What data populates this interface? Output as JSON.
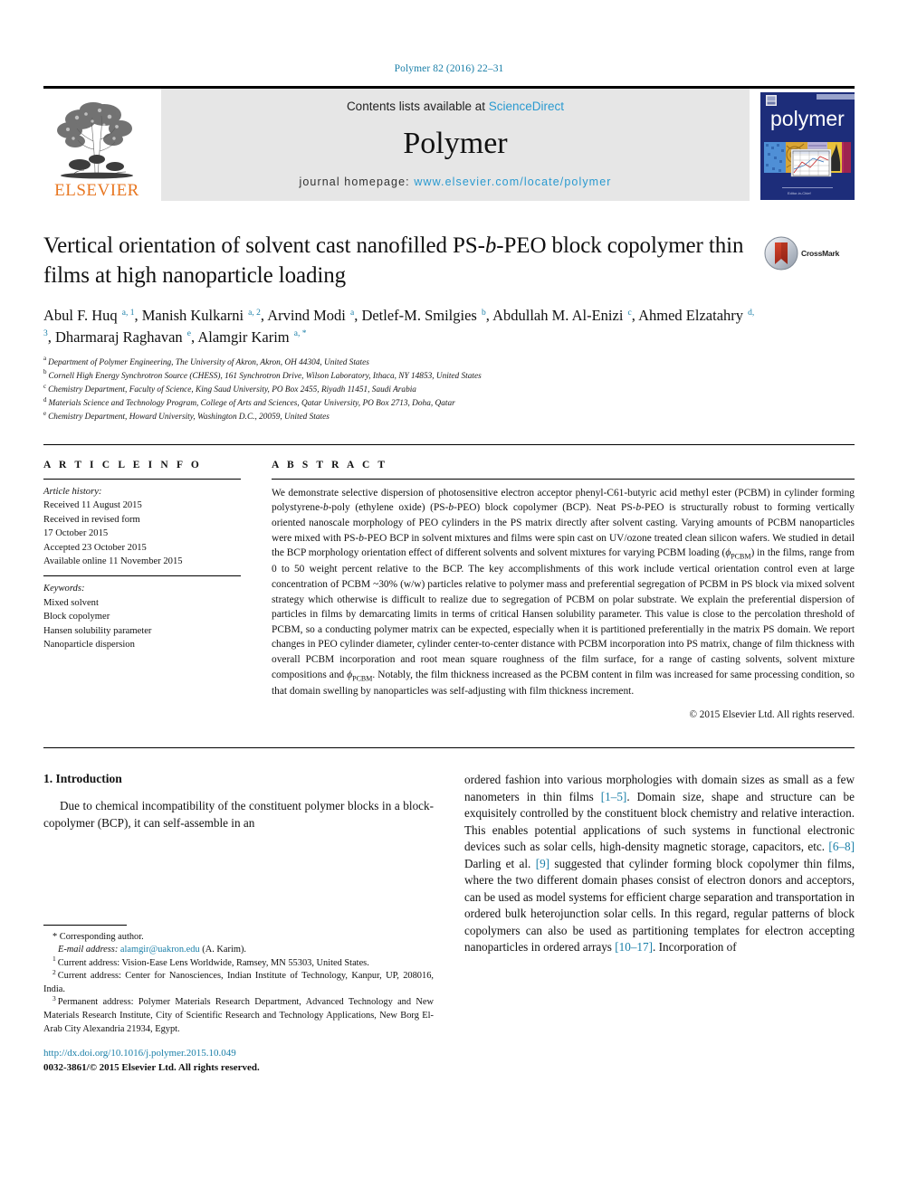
{
  "running_head": "Polymer 82 (2016) 22–31",
  "masthead": {
    "publisher_name": "ELSEVIER",
    "contents_prefix": "Contents lists available at ",
    "contents_link": "ScienceDirect",
    "journal_name": "Polymer",
    "homepage_prefix": "journal homepage: ",
    "homepage_url": "www.elsevier.com/locate/polymer",
    "cover_title": "polymer",
    "link_color": "#2a9ad0",
    "brand_color": "#E87722"
  },
  "article": {
    "title": "Vertical orientation of solvent cast nanofilled PS-b-PEO block copolymer thin films at high nanoparticle loading",
    "crossmark_label": "CrossMark",
    "authors": [
      {
        "name": "Abul F. Huq",
        "sup": "a, 1",
        "sep": ", "
      },
      {
        "name": "Manish Kulkarni",
        "sup": "a, 2",
        "sep": ", "
      },
      {
        "name": "Arvind Modi",
        "sup": "a",
        "sep": ", "
      },
      {
        "name": "Detlef-M. Smilgies",
        "sup": "b",
        "sep": ", "
      },
      {
        "name": "Abdullah M. Al-Enizi",
        "sup": "c",
        "sep": ", "
      },
      {
        "name": "Ahmed Elzatahry",
        "sup": "d, 3",
        "sep": ", "
      },
      {
        "name": "Dharmaraj Raghavan",
        "sup": "e",
        "sep": ", "
      },
      {
        "name": "Alamgir Karim",
        "sup": "a, *",
        "sep": ""
      }
    ],
    "affiliations": [
      {
        "mark": "a",
        "text": "Department of Polymer Engineering, The University of Akron, Akron, OH 44304, United States"
      },
      {
        "mark": "b",
        "text": "Cornell High Energy Synchrotron Source (CHESS), 161 Synchrotron Drive, Wilson Laboratory, Ithaca, NY 14853, United States"
      },
      {
        "mark": "c",
        "text": "Chemistry Department, Faculty of Science, King Saud University, PO Box 2455, Riyadh 11451, Saudi Arabia"
      },
      {
        "mark": "d",
        "text": "Materials Science and Technology Program, College of Arts and Sciences, Qatar University, PO Box 2713, Doha, Qatar"
      },
      {
        "mark": "e",
        "text": "Chemistry Department, Howard University, Washington D.C., 20059, United States"
      }
    ]
  },
  "article_info": {
    "heading": "A R T I C L E   I N F O",
    "history_label": "Article history:",
    "history": [
      "Received 11 August 2015",
      "Received in revised form",
      "17 October 2015",
      "Accepted 23 October 2015",
      "Available online 11 November 2015"
    ],
    "keywords_label": "Keywords:",
    "keywords": [
      "Mixed solvent",
      "Block copolymer",
      "Hansen solubility parameter",
      "Nanoparticle dispersion"
    ]
  },
  "abstract": {
    "heading": "A B S T R A C T",
    "paragraph_part1": "We demonstrate selective dispersion of photosensitive electron acceptor phenyl-C61-butyric acid methyl ester (PCBM) in cylinder forming polystyrene-",
    "italic1": "b",
    "paragraph_part2": "-poly (ethylene oxide) (PS-",
    "italic2": "b",
    "paragraph_part3": "-PEO) block copolymer (BCP). Neat PS-",
    "italic3": "b",
    "paragraph_part4": "-PEO is structurally robust to forming vertically oriented nanoscale morphology of PEO cylinders in the PS matrix directly after solvent casting. Varying amounts of PCBM nanoparticles were mixed with PS-",
    "italic4": "b",
    "paragraph_part5": "-PEO BCP in solvent mixtures and films were spin cast on UV/ozone treated clean silicon wafers. We studied in detail the BCP morphology orientation effect of different solvents and solvent mixtures for varying PCBM loading (",
    "phi1": "ϕ",
    "phi1_sub": "PCBM",
    "paragraph_part6": ") in the films, range from 0 to 50 weight percent relative to the BCP. The key accomplishments of this work include vertical orientation control even at large concentration of PCBM ~30% (w/w) particles relative to polymer mass and preferential segregation of PCBM in PS block via mixed solvent strategy which otherwise is difficult to realize due to segregation of PCBM on polar substrate. We explain the preferential dispersion of particles in films by demarcating limits in terms of critical Hansen solubility parameter. This value is close to the percolation threshold of PCBM, so a conducting polymer matrix can be expected, especially when it is partitioned preferentially in the matrix PS domain. We report changes in PEO cylinder diameter, cylinder center-to-center distance with PCBM incorporation into PS matrix, change of film thickness with overall PCBM incorporation and root mean square roughness of the film surface, for a range of casting solvents, solvent mixture compositions and ",
    "phi2": "ϕ",
    "phi2_sub": "PCBM",
    "paragraph_part7": ". Notably, the film thickness increased as the PCBM content in film was increased for same processing condition, so that domain swelling by nanoparticles was self-adjusting with film thickness increment.",
    "copyright": "© 2015 Elsevier Ltd. All rights reserved."
  },
  "introduction": {
    "heading": "1. Introduction",
    "left_para": "Due to chemical incompatibility of the constituent polymer blocks in a block-copolymer (BCP), it can self-assemble in an",
    "right_part1": "ordered fashion into various morphologies with domain sizes as small as a few nanometers in thin films ",
    "right_ref1": "[1–5]",
    "right_part2": ". Domain size, shape and structure can be exquisitely controlled by the constituent block chemistry and relative interaction. This enables potential applications of such systems in functional electronic devices such as solar cells, high-density magnetic storage, capacitors, etc. ",
    "right_ref2": "[6–8]",
    "right_part3": " Darling et al. ",
    "right_ref3": "[9]",
    "right_part4": " suggested that cylinder forming block copolymer thin films, where the two different domain phases consist of electron donors and acceptors, can be used as model systems for efficient charge separation and transportation in ordered bulk heterojunction solar cells. In this regard, regular patterns of block copolymers can also be used as partitioning templates for electron accepting nanoparticles in ordered arrays ",
    "right_ref4": "[10–17]",
    "right_part5": ". Incorporation of"
  },
  "footnotes": {
    "corresponding": "* Corresponding author.",
    "email_label": "E-mail address:",
    "email": "alamgir@uakron.edu",
    "email_attrib": "(A. Karim).",
    "note1_mark": "1",
    "note1": "Current address: Vision-Ease Lens Worldwide, Ramsey, MN 55303, United States.",
    "note2_mark": "2",
    "note2": "Current address: Center for Nanosciences, Indian Institute of Technology, Kanpur, UP, 208016, India.",
    "note3_mark": "3",
    "note3": "Permanent address: Polymer Materials Research Department, Advanced Technology and New Materials Research Institute, City of Scientific Research and Technology Applications, New Borg El-Arab City Alexandria 21934, Egypt.",
    "doi": "http://dx.doi.org/10.1016/j.polymer.2015.10.049",
    "issn_line": "0032-3861/© 2015 Elsevier Ltd. All rights reserved."
  }
}
